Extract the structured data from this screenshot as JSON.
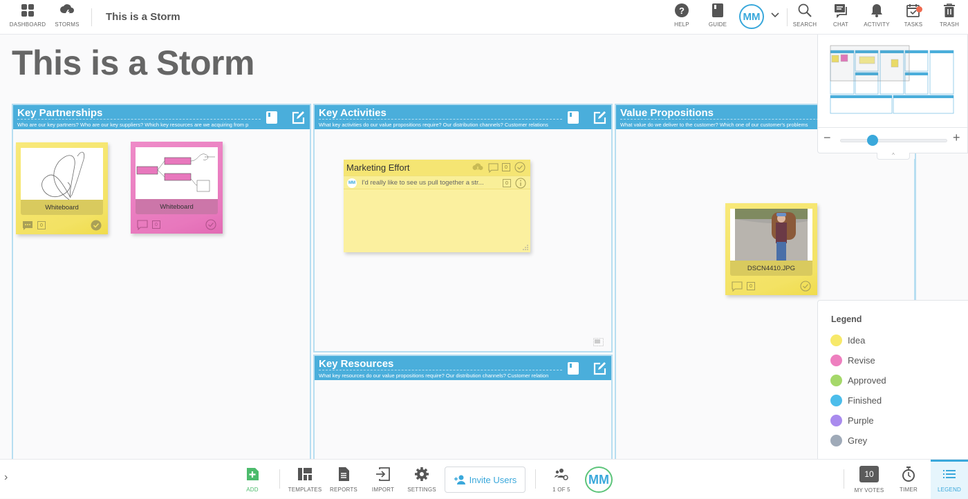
{
  "topbar": {
    "left_items": [
      {
        "label": "DASHBOARD",
        "icon": "grid-icon"
      },
      {
        "label": "STORMS",
        "icon": "storm-cloud-icon"
      }
    ],
    "storm_name": "This is a Storm",
    "right_items": [
      {
        "label": "HELP",
        "icon": "help-icon"
      },
      {
        "label": "GUIDE",
        "icon": "guide-book-icon"
      }
    ],
    "user_initials": "MM",
    "tool_items": [
      {
        "label": "SEARCH",
        "icon": "search-icon"
      },
      {
        "label": "CHAT",
        "icon": "chat-icon"
      },
      {
        "label": "ACTIVITY",
        "icon": "bell-icon"
      },
      {
        "label": "TASKS",
        "icon": "calendar-check-icon",
        "has_notification": true
      },
      {
        "label": "TRASH",
        "icon": "trash-icon"
      }
    ]
  },
  "board": {
    "title": "This is a Storm",
    "lanes": [
      {
        "title": "Key Partnerships",
        "description": "Who are our key partners? Who are our key suppliers? Which key resources are we acquiring from p"
      },
      {
        "title": "Key Activities",
        "description": "What key activities do our value propositions require? Our distribution channels? Customer relations"
      },
      {
        "title": "Value Propositions",
        "description": "What value do we deliver to the customer? Which one of our customer's problems"
      },
      {
        "title": "Key Resources",
        "description": "What key resources do our value propositions require? Our distribution channels? Customer relation"
      }
    ],
    "notes": [
      {
        "type": "whiteboard",
        "color": "yellow",
        "caption": "Whiteboard",
        "votes": "0",
        "lane": "Key Partnerships"
      },
      {
        "type": "whiteboard",
        "color": "pink",
        "caption": "Whiteboard",
        "votes": "0",
        "lane": "Key Partnerships"
      },
      {
        "type": "text",
        "color": "yellow",
        "title": "Marketing Effort",
        "votes": "0",
        "lane": "Key Activities",
        "comment": {
          "author_initials": "MM",
          "text": "I'd really like to see us pull together a str...",
          "votes": "0"
        }
      },
      {
        "type": "image",
        "color": "yellow",
        "caption": "DSCN4410.JPG",
        "votes": "0",
        "lane": "Value Propositions"
      }
    ]
  },
  "minimap": {
    "zoom_minus": "−",
    "zoom_plus": "+",
    "zoom_level": 0.3,
    "collapse": "^"
  },
  "legend": {
    "title": "Legend",
    "items": [
      {
        "label": "Idea",
        "color": "#f7e96a"
      },
      {
        "label": "Revise",
        "color": "#ee7fbf"
      },
      {
        "label": "Approved",
        "color": "#a5d86a"
      },
      {
        "label": "Finished",
        "color": "#4cbdeb"
      },
      {
        "label": "Purple",
        "color": "#a98bee"
      },
      {
        "label": "Grey",
        "color": "#9faab8"
      }
    ]
  },
  "bottombar": {
    "expand": "›",
    "add_label": "ADD",
    "items": [
      {
        "label": "TEMPLATES",
        "icon": "templates-icon"
      },
      {
        "label": "REPORTS",
        "icon": "report-icon"
      },
      {
        "label": "IMPORT",
        "icon": "import-icon"
      },
      {
        "label": "SETTINGS",
        "icon": "gear-icon"
      }
    ],
    "invite_label": "Invite Users",
    "users_label": "1 OF 5",
    "user_initials": "MM",
    "votes_count": "10",
    "votes_label": "MY VOTES",
    "timer_label": "TIMER",
    "legend_label": "LEGEND"
  },
  "colors": {
    "accent": "#3aa8db",
    "lane_header": "#4aaedb",
    "add_green": "#4cbb6c"
  }
}
